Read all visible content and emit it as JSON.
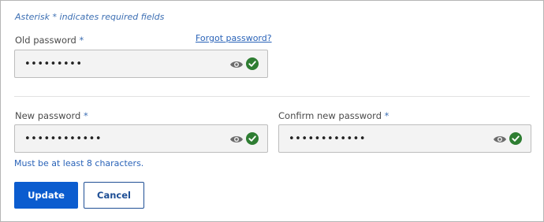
{
  "form": {
    "required_note": "Asterisk * indicates required fields",
    "required_marker": "*",
    "old_password": {
      "label": "Old password",
      "value": "•••••••••",
      "forgot_link": "Forgot password?"
    },
    "new_password": {
      "label": "New password",
      "value": "••••••••••••"
    },
    "confirm_password": {
      "label": "Confirm new password",
      "value": "••••••••••••"
    },
    "hint": "Must be at least 8 characters.",
    "update_label": "Update",
    "cancel_label": "Cancel"
  },
  "icons": {
    "visibility": "eye-icon",
    "valid": "check-circle-icon"
  },
  "colors": {
    "primary": "#0b5ccf",
    "link": "#2a63b8",
    "valid": "#2e7d32",
    "field_bg": "#f3f3f3"
  }
}
